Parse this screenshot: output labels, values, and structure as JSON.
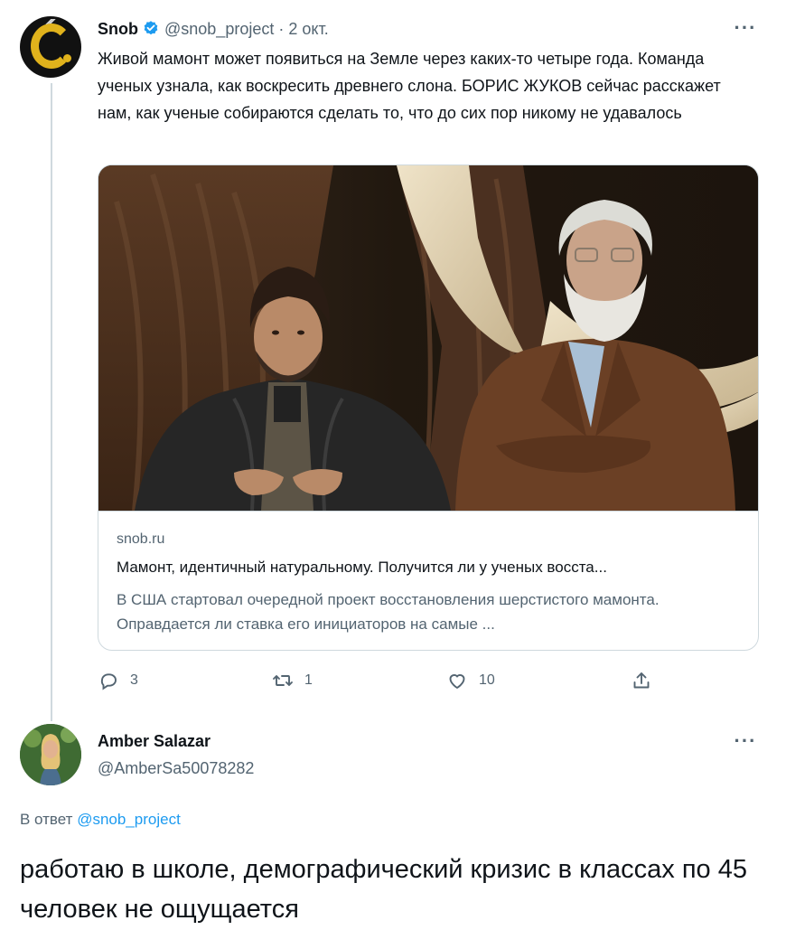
{
  "tweet": {
    "author_name": "Snob",
    "author_handle": "@snob_project",
    "separator": "·",
    "date": "2 окт.",
    "text": "Живой мамонт может появиться на Земле через каких-то четыре года. Команда ученых узнала, как воскресить древнего слона. БОРИС ЖУКОВ сейчас расскажет нам, как ученые собираются сделать то, что до сих пор никому не удавалось",
    "card": {
      "domain": "snob.ru",
      "title": "Мамонт, идентичный натуральному. Получится ли у ученых восста...",
      "description": "В США стартовал очередной проект восстановления шерстистого мамонта. Оправдается ли ставка его инициаторов на самые ..."
    },
    "stats": {
      "replies": "3",
      "retweets": "1",
      "likes": "10"
    }
  },
  "reply": {
    "author_name": "Amber Salazar",
    "author_handle": "@AmberSa50078282",
    "reply_prefix": "В ответ",
    "reply_to_handle": "@snob_project",
    "text": "работаю в школе, демографический кризис в классах по 45 человек не ощущается"
  },
  "colors": {
    "text_primary": "#0f1419",
    "text_secondary": "#536471",
    "accent": "#1d9bf0",
    "border": "#cfd9de",
    "snob_gold": "#e0b21c"
  },
  "icons": [
    "verified-badge-icon",
    "more-options-icon",
    "reply-icon",
    "retweet-icon",
    "like-icon",
    "share-icon"
  ]
}
